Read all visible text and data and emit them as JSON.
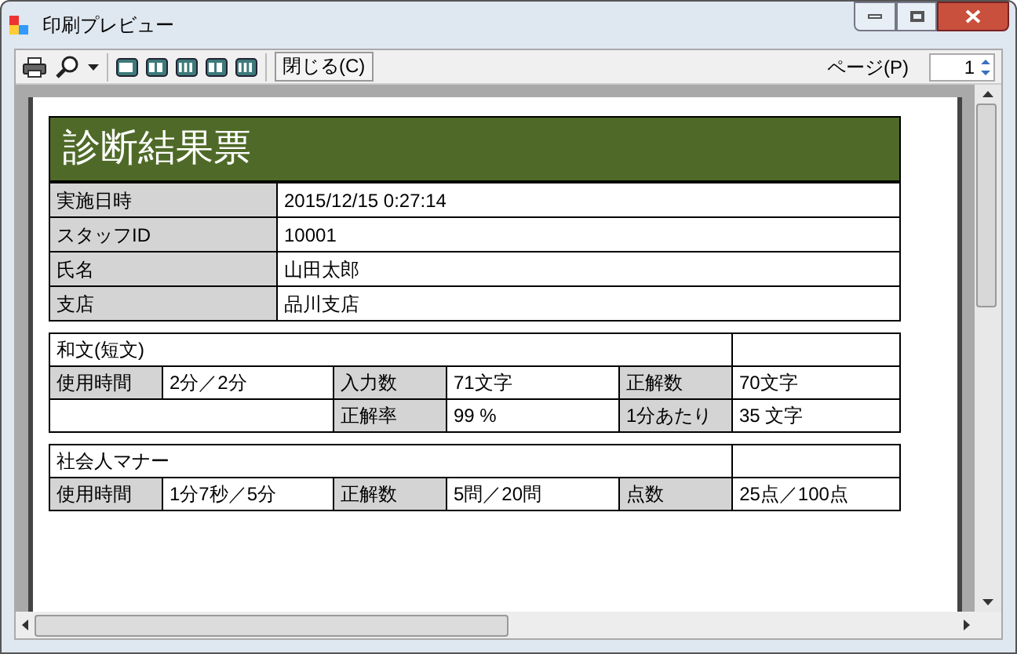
{
  "window": {
    "title": "印刷プレビュー"
  },
  "toolbar": {
    "close_button": "閉じる(C)",
    "page_label": "ページ(P)",
    "page_value": "1"
  },
  "report": {
    "title": "診断結果票",
    "info": [
      {
        "label": "実施日時",
        "value": "2015/12/15 0:27:14"
      },
      {
        "label": "スタッフID",
        "value": "10001"
      },
      {
        "label": "氏名",
        "value": "山田太郎"
      },
      {
        "label": "支店",
        "value": "品川支店"
      }
    ],
    "sections": [
      {
        "title": "和文(短文)",
        "rows": [
          [
            {
              "kind": "label",
              "text": "使用時間"
            },
            {
              "kind": "value",
              "text": "2分／2分"
            },
            {
              "kind": "label",
              "text": "入力数"
            },
            {
              "kind": "value",
              "text": "71文字"
            },
            {
              "kind": "label",
              "text": "正解数"
            },
            {
              "kind": "value",
              "text": "70文字"
            }
          ],
          [
            {
              "kind": "blank"
            },
            {
              "kind": "merged"
            },
            {
              "kind": "label",
              "text": "正解率"
            },
            {
              "kind": "value",
              "text": "99 %"
            },
            {
              "kind": "label",
              "text": "1分あたり"
            },
            {
              "kind": "value",
              "text": "35 文字"
            }
          ]
        ]
      },
      {
        "title": "社会人マナー",
        "rows": [
          [
            {
              "kind": "label",
              "text": "使用時間"
            },
            {
              "kind": "value",
              "text": "1分7秒／5分"
            },
            {
              "kind": "label",
              "text": "正解数"
            },
            {
              "kind": "value",
              "text": "5問／20問"
            },
            {
              "kind": "label",
              "text": "点数"
            },
            {
              "kind": "value",
              "text": "25点／100点"
            }
          ]
        ]
      }
    ]
  }
}
